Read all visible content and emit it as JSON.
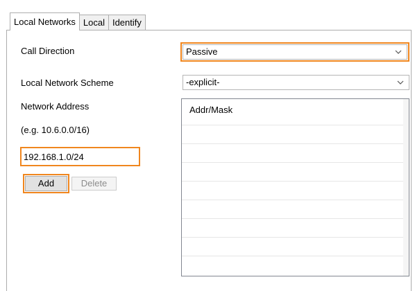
{
  "tabs": [
    {
      "label": "Local Networks",
      "active": true
    },
    {
      "label": "Local",
      "active": false
    },
    {
      "label": "Identify",
      "active": false
    }
  ],
  "call_direction": {
    "label": "Call Direction",
    "value": "Passive"
  },
  "network_scheme": {
    "label": "Local Network Scheme",
    "value": "-explicit-"
  },
  "network_address": {
    "label": "Network Address",
    "hint": "(e.g. 10.6.0.0/16)",
    "value": "192.168.1.0/24"
  },
  "buttons": {
    "add": "Add",
    "delete": "Delete"
  },
  "list": {
    "header": "Addr/Mask",
    "items": []
  },
  "colors": {
    "highlight": "#f0861e",
    "border": "#adadad",
    "disabled_text": "#8c8c8c"
  }
}
